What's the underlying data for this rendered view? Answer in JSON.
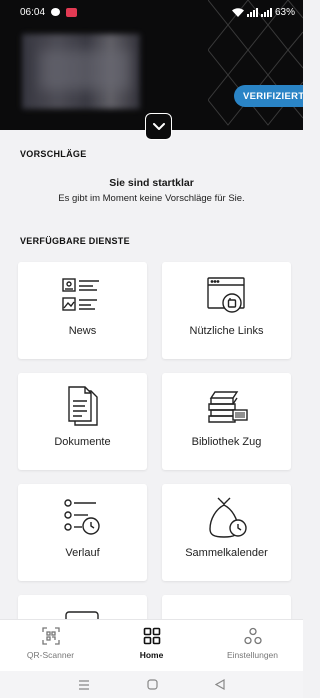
{
  "status_bar": {
    "time": "06:04",
    "battery": "63%"
  },
  "header": {
    "verify_label": "VERIFIZIERT"
  },
  "suggestions": {
    "heading": "VORSCHLÄGE",
    "title": "Sie sind startklar",
    "text": "Es gibt im Moment keine Vorschläge für Sie."
  },
  "services": {
    "heading": "VERFÜGBARE DIENSTE",
    "tiles": [
      {
        "label": "News",
        "icon": "news-icon"
      },
      {
        "label": "Nützliche Links",
        "icon": "browser-link-icon"
      },
      {
        "label": "Dokumente",
        "icon": "documents-icon"
      },
      {
        "label": "Bibliothek Zug",
        "icon": "library-books-icon"
      },
      {
        "label": "Verlauf",
        "icon": "history-list-icon"
      },
      {
        "label": "Sammelkalender",
        "icon": "garbage-bag-clock-icon"
      }
    ]
  },
  "bottom_nav": [
    {
      "label": "QR-Scanner",
      "icon": "qr-scanner-icon"
    },
    {
      "label": "Home",
      "icon": "home-grid-icon",
      "active": true
    },
    {
      "label": "Einstellungen",
      "icon": "settings-icon"
    }
  ],
  "colors": {
    "accent": "#2a84c6",
    "header_bg": "#0b0b0c",
    "page_bg": "#f2f2f4"
  }
}
